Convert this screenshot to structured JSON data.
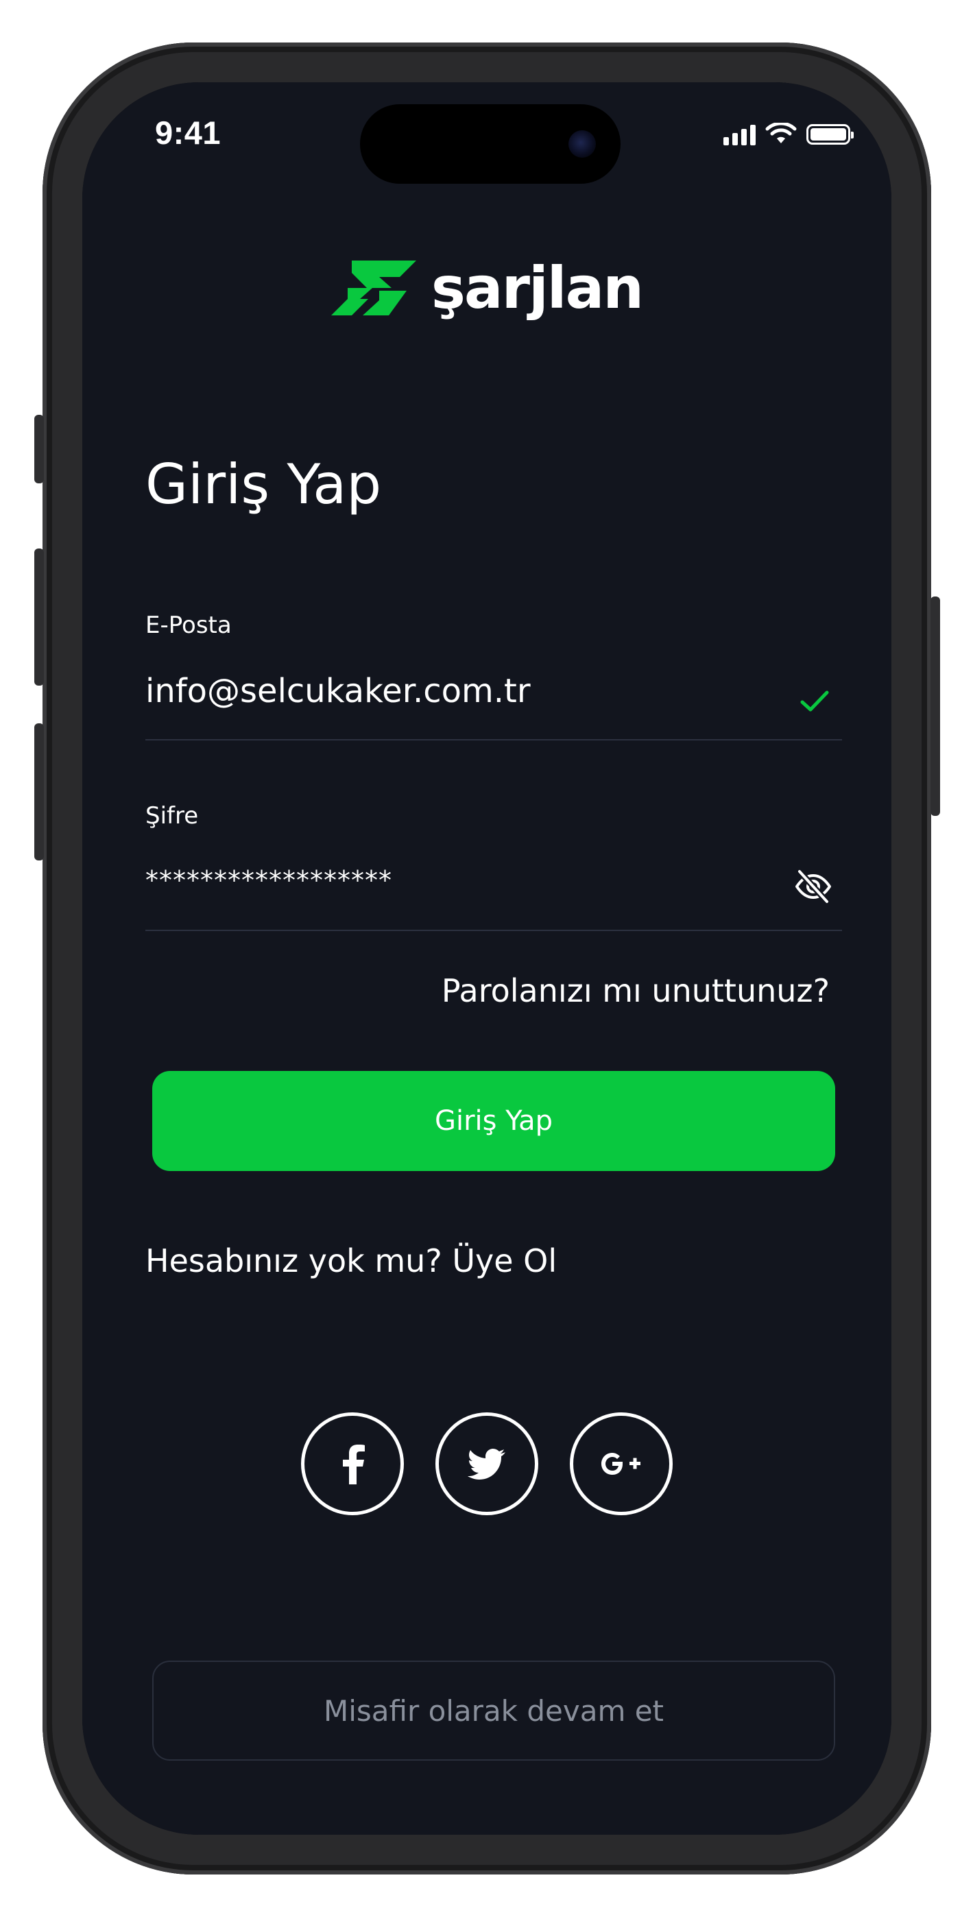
{
  "status_bar": {
    "time": "9:41"
  },
  "brand": {
    "name": "şarjlan",
    "accent_color": "#09c83f",
    "logo_icon": "lightning-bolt-logo-icon"
  },
  "login": {
    "title": "Giriş Yap",
    "email": {
      "label": "E-Posta",
      "value": "info@selcukaker.com.tr",
      "valid_icon": "checkmark-icon"
    },
    "password": {
      "label": "Şifre",
      "value": "******************",
      "toggle_icon": "eye-slash-icon"
    },
    "forgot_password": "Parolanızı mı unuttunuz?",
    "submit_label": "Giriş Yap",
    "signup_prompt": "Hesabınız yok mu? Üye Ol"
  },
  "social": [
    {
      "name": "facebook",
      "icon": "facebook-icon"
    },
    {
      "name": "twitter",
      "icon": "twitter-icon"
    },
    {
      "name": "google-plus",
      "icon": "google-plus-icon"
    }
  ],
  "guest_label": "Misafir olarak devam et"
}
